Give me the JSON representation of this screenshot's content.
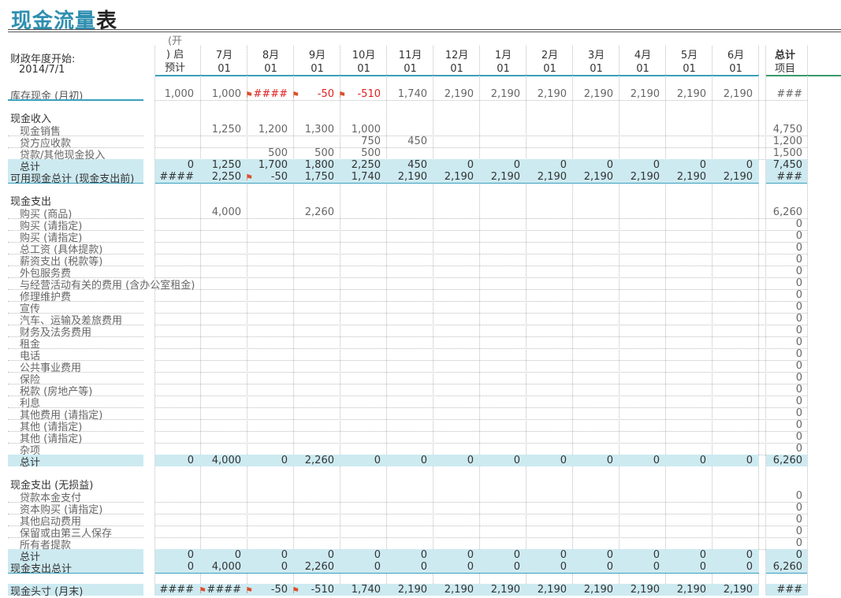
{
  "title": {
    "part1": "现金流量",
    "part2": "表"
  },
  "header": {
    "fiscal_label": "财政年度开始:",
    "fiscal_date": "2014/7/1",
    "pre_col": {
      "line1": "(开",
      "line2": ") 启",
      "line3": "预计"
    },
    "months": [
      {
        "m": "7月",
        "d": "01"
      },
      {
        "m": "8月",
        "d": "01"
      },
      {
        "m": "9月",
        "d": "01"
      },
      {
        "m": "10月",
        "d": "01"
      },
      {
        "m": "11月",
        "d": "01"
      },
      {
        "m": "12月",
        "d": "01"
      },
      {
        "m": "1月",
        "d": "01"
      },
      {
        "m": "2月",
        "d": "01"
      },
      {
        "m": "3月",
        "d": "01"
      },
      {
        "m": "4月",
        "d": "01"
      },
      {
        "m": "5月",
        "d": "01"
      },
      {
        "m": "6月",
        "d": "01"
      }
    ],
    "total_col": {
      "line1": "总计",
      "line2": "项目"
    }
  },
  "opening": {
    "name": "库存现金 (月初)",
    "pre": "1,000",
    "values": [
      "1,000",
      "####",
      "-50",
      "-510",
      "1,740",
      "2,190",
      "2,190",
      "2,190",
      "2,190",
      "2,190",
      "2,190",
      "2,190"
    ],
    "total": "###"
  },
  "income": {
    "heading": "现金收入",
    "rows": [
      {
        "name": "现金销售",
        "pre": "",
        "values": [
          "1,250",
          "1,200",
          "1,300",
          "1,000",
          "",
          "",
          "",
          "",
          "",
          "",
          "",
          ""
        ],
        "total": "4,750"
      },
      {
        "name": "贷方应收款",
        "pre": "",
        "values": [
          "",
          "",
          "",
          "750",
          "450",
          "",
          "",
          "",
          "",
          "",
          "",
          ""
        ],
        "total": "1,200"
      },
      {
        "name": "贷款/其他现金投入",
        "pre": "",
        "values": [
          "",
          "500",
          "500",
          "500",
          "",
          "",
          "",
          "",
          "",
          "",
          "",
          ""
        ],
        "total": "1,500"
      }
    ],
    "total": {
      "name": "总计",
      "pre": "0",
      "values": [
        "1,250",
        "1,700",
        "1,800",
        "2,250",
        "450",
        "0",
        "0",
        "0",
        "0",
        "0",
        "0",
        "0"
      ],
      "total": "7,450"
    },
    "available": {
      "name": "可用现金总计 (现金支出前)",
      "pre": "####",
      "values": [
        "2,250",
        "-50",
        "1,750",
        "1,740",
        "2,190",
        "2,190",
        "2,190",
        "2,190",
        "2,190",
        "2,190",
        "2,190",
        "2,190"
      ],
      "total": "###"
    }
  },
  "expense": {
    "heading": "现金支出",
    "rows": [
      {
        "name": "购买 (商品)",
        "values": [
          "4,000",
          "",
          "2,260",
          "",
          "",
          "",
          "",
          "",
          "",
          "",
          "",
          ""
        ],
        "total": "6,260"
      },
      {
        "name": "购买 (请指定)",
        "values": [
          "",
          "",
          "",
          "",
          "",
          "",
          "",
          "",
          "",
          "",
          "",
          ""
        ],
        "total": "0"
      },
      {
        "name": "购买 (请指定)",
        "values": [
          "",
          "",
          "",
          "",
          "",
          "",
          "",
          "",
          "",
          "",
          "",
          ""
        ],
        "total": "0"
      },
      {
        "name": "总工资 (具体提款)",
        "values": [
          "",
          "",
          "",
          "",
          "",
          "",
          "",
          "",
          "",
          "",
          "",
          ""
        ],
        "total": "0"
      },
      {
        "name": "薪资支出 (税款等)",
        "values": [
          "",
          "",
          "",
          "",
          "",
          "",
          "",
          "",
          "",
          "",
          "",
          ""
        ],
        "total": "0"
      },
      {
        "name": "外包服务费",
        "values": [
          "",
          "",
          "",
          "",
          "",
          "",
          "",
          "",
          "",
          "",
          "",
          ""
        ],
        "total": "0"
      },
      {
        "name": "与经营活动有关的费用 (含办公室租金)",
        "values": [
          "",
          "",
          "",
          "",
          "",
          "",
          "",
          "",
          "",
          "",
          "",
          ""
        ],
        "total": "0"
      },
      {
        "name": "修理维护费",
        "values": [
          "",
          "",
          "",
          "",
          "",
          "",
          "",
          "",
          "",
          "",
          "",
          ""
        ],
        "total": "0"
      },
      {
        "name": "宣传",
        "values": [
          "",
          "",
          "",
          "",
          "",
          "",
          "",
          "",
          "",
          "",
          "",
          ""
        ],
        "total": "0"
      },
      {
        "name": "汽车、运输及差旅费用",
        "values": [
          "",
          "",
          "",
          "",
          "",
          "",
          "",
          "",
          "",
          "",
          "",
          ""
        ],
        "total": "0"
      },
      {
        "name": "财务及法务费用",
        "values": [
          "",
          "",
          "",
          "",
          "",
          "",
          "",
          "",
          "",
          "",
          "",
          ""
        ],
        "total": "0"
      },
      {
        "name": "租金",
        "values": [
          "",
          "",
          "",
          "",
          "",
          "",
          "",
          "",
          "",
          "",
          "",
          ""
        ],
        "total": "0"
      },
      {
        "name": "电话",
        "values": [
          "",
          "",
          "",
          "",
          "",
          "",
          "",
          "",
          "",
          "",
          "",
          ""
        ],
        "total": "0"
      },
      {
        "name": "公共事业费用",
        "values": [
          "",
          "",
          "",
          "",
          "",
          "",
          "",
          "",
          "",
          "",
          "",
          ""
        ],
        "total": "0"
      },
      {
        "name": "保险",
        "values": [
          "",
          "",
          "",
          "",
          "",
          "",
          "",
          "",
          "",
          "",
          "",
          ""
        ],
        "total": "0"
      },
      {
        "name": "税款 (房地产等)",
        "values": [
          "",
          "",
          "",
          "",
          "",
          "",
          "",
          "",
          "",
          "",
          "",
          ""
        ],
        "total": "0"
      },
      {
        "name": "利息",
        "values": [
          "",
          "",
          "",
          "",
          "",
          "",
          "",
          "",
          "",
          "",
          "",
          ""
        ],
        "total": "0"
      },
      {
        "name": "其他费用 (请指定)",
        "values": [
          "",
          "",
          "",
          "",
          "",
          "",
          "",
          "",
          "",
          "",
          "",
          ""
        ],
        "total": "0"
      },
      {
        "name": "其他 (请指定)",
        "values": [
          "",
          "",
          "",
          "",
          "",
          "",
          "",
          "",
          "",
          "",
          "",
          ""
        ],
        "total": "0"
      },
      {
        "name": "其他 (请指定)",
        "values": [
          "",
          "",
          "",
          "",
          "",
          "",
          "",
          "",
          "",
          "",
          "",
          ""
        ],
        "total": "0"
      },
      {
        "name": "杂项",
        "values": [
          "",
          "",
          "",
          "",
          "",
          "",
          "",
          "",
          "",
          "",
          "",
          ""
        ],
        "total": "0"
      }
    ],
    "total": {
      "name": "总计",
      "pre": "0",
      "values": [
        "4,000",
        "0",
        "2,260",
        "0",
        "0",
        "0",
        "0",
        "0",
        "0",
        "0",
        "0",
        "0"
      ],
      "total": "6,260"
    }
  },
  "nonpl": {
    "heading": "现金支出 (无损益)",
    "rows": [
      {
        "name": "贷款本金支付",
        "total": "0"
      },
      {
        "name": "资本购买 (请指定)",
        "total": "0"
      },
      {
        "name": "其他启动费用",
        "total": "0"
      },
      {
        "name": "保留或由第三人保存",
        "total": "0"
      },
      {
        "name": "所有者提款",
        "total": "0"
      }
    ],
    "total": {
      "name": "总计",
      "pre": "0",
      "values": [
        "0",
        "0",
        "0",
        "0",
        "0",
        "0",
        "0",
        "0",
        "0",
        "0",
        "0",
        "0"
      ],
      "total": "0"
    },
    "grand": {
      "name": "现金支出总计",
      "pre": "0",
      "values": [
        "4,000",
        "0",
        "2,260",
        "0",
        "0",
        "0",
        "0",
        "0",
        "0",
        "0",
        "0",
        "0"
      ],
      "total": "6,260"
    }
  },
  "closing": {
    "name": "现金头寸 (月末)",
    "pre": "####",
    "values": [
      "####",
      "-50",
      "-510",
      "1,740",
      "2,190",
      "2,190",
      "2,190",
      "2,190",
      "2,190",
      "2,190",
      "2,190",
      "2,190"
    ],
    "total": "###"
  },
  "colors": {
    "accent": "#2f8fb0",
    "band": "#cdeaf1",
    "negative": "#e02020",
    "flag": "#d9502a"
  }
}
